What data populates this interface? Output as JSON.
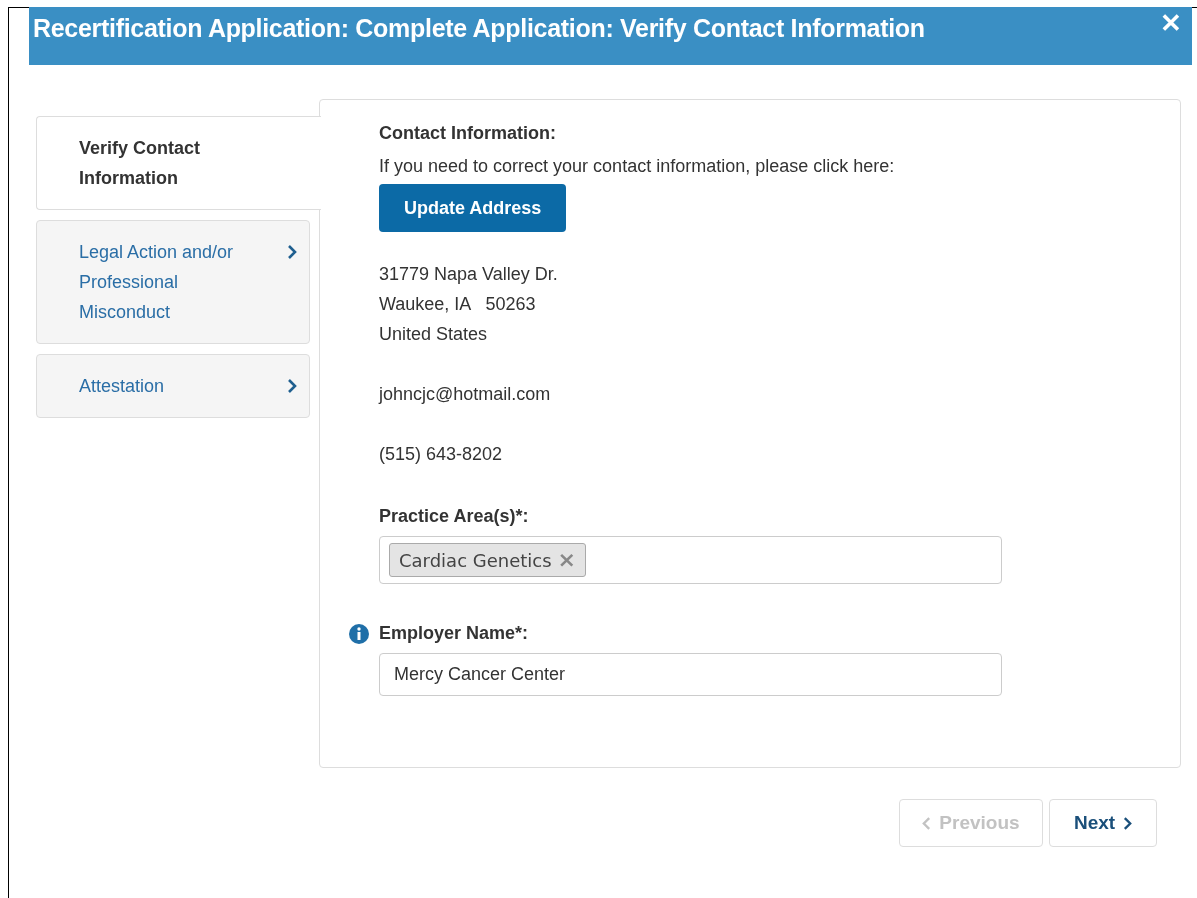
{
  "dialog": {
    "title": "Recertification Application: Complete Application: Verify Contact Information",
    "close": "✕"
  },
  "steps": [
    {
      "label": "Verify Contact Information",
      "selected": true
    },
    {
      "label": "Legal Action and/or Professional Misconduct",
      "selected": false
    },
    {
      "label": "Attestation",
      "selected": false
    }
  ],
  "contact": {
    "heading": "Contact Information:",
    "instruction": "If you need to correct your contact information, please click here:",
    "button": "Update Address",
    "address_lines": [
      "31779 Napa Valley Dr.",
      "Waukee, IA   50263",
      "United States"
    ],
    "email": "johncjc@hotmail.com",
    "phone": "(515) 643-8202"
  },
  "practice_area": {
    "label": "Practice Area(s)*:",
    "tags": [
      {
        "label": "Cardiac Genetics",
        "remove": "×"
      }
    ]
  },
  "employer": {
    "label": "Employer Name*:",
    "value": "Mercy Cancer Center"
  },
  "nav": [
    {
      "kind": "previous",
      "label": "Previous",
      "disabled": true
    },
    {
      "kind": "next",
      "label": "Next",
      "disabled": false
    }
  ]
}
